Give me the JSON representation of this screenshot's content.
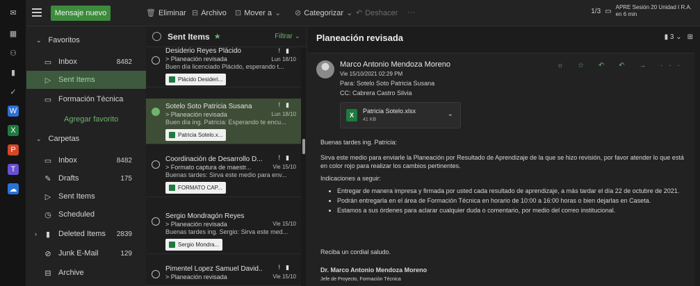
{
  "toolbar": {
    "new_message": "Mensaje nuevo",
    "delete": "Eliminar",
    "archive": "Archivo",
    "move_to": "Mover a",
    "categorize": "Categorizar",
    "undo": "Deshacer",
    "more": "···",
    "page_indicator": "1/3",
    "event_line1": "APRE Sesión 20 Unidad I R.A.",
    "event_line2": "en 6 min"
  },
  "nav": {
    "favorites_label": "Favoritos",
    "favorites": [
      {
        "label": "Inbox",
        "count": "8482",
        "icon": "inbox-icon"
      },
      {
        "label": "Sent Items",
        "count": "",
        "icon": "send-icon"
      },
      {
        "label": "Formación Técnica",
        "count": "",
        "icon": "folder-icon"
      }
    ],
    "add_favorite": "Agregar favorito",
    "folders_label": "Carpetas",
    "folders": [
      {
        "label": "Inbox",
        "count": "8482",
        "icon": "inbox-icon"
      },
      {
        "label": "Drafts",
        "count": "175",
        "icon": "pencil-icon"
      },
      {
        "label": "Sent Items",
        "count": "",
        "icon": "send-icon"
      },
      {
        "label": "Scheduled",
        "count": "",
        "icon": "clock-icon"
      },
      {
        "label": "Deleted Items",
        "count": "2839",
        "icon": "trash-icon"
      },
      {
        "label": "Junk E-Mail",
        "count": "129",
        "icon": "block-icon"
      },
      {
        "label": "Archive",
        "count": "",
        "icon": "archive-icon"
      }
    ]
  },
  "list": {
    "title": "Sent Items",
    "filter": "Filtrar",
    "messages": [
      {
        "from": "Desiderio Reyes Plácido",
        "subject": "> Planeación revisada",
        "date": "Lun 18/10",
        "preview": "Buen día licenciado Plácido, esperando t...",
        "attachment": "Plácido Desideri..."
      },
      {
        "from": "Sotelo Soto Patricia Susana",
        "subject": "> Planeación revisada",
        "date": "Lun 18/10",
        "preview": "Buen día ing. Patricia: Esperando te encu...",
        "attachment": "Patricia Sotelo.x..."
      },
      {
        "from": "Coordinación de Desarrollo D...",
        "subject": "> Formato captura de maestr...",
        "date": "Vie 15/10",
        "preview": "Buenas tardes: Sirva este medio para env...",
        "attachment": "FORMATO CAP..."
      },
      {
        "from": "Sergio Mondragón Reyes",
        "subject": "> Planeación revisada",
        "date": "Vie 15/10",
        "preview": "Buenas tardes ing. Sergio: Sirva este med...",
        "attachment": "Sergio Mondra..."
      },
      {
        "from": "Pimentel Lopez Samuel David...",
        "subject": "> Planeación revisada",
        "date": "Vie 15/10",
        "preview": "",
        "attachment": ""
      }
    ]
  },
  "reading": {
    "title": "Planeación revisada",
    "thread_count": "3",
    "sender": "Marco Antonio Mendoza Moreno",
    "sent": "Vie 15/10/2021 02:29 PM",
    "to": "Para: Sotelo Soto Patricia Susana",
    "cc": "CC: Cabrera Castro Silvia",
    "file_name": "Patricia Sotelo.xlsx",
    "file_size": "41 KB",
    "greeting": "Buenas tardes ing. Patricia:",
    "para1": "Sirva este medio para enviarle la Planeación por Resultado de Aprendizaje de la que se hizo revisión, por favor atender lo que está en color rojo para realizar los cambios pertinentes.",
    "indications": "Indicaciones a seguir:",
    "bullets": [
      "Entregar de manera impresa y firmada por usted cada resultado de aprendizaje, a más tardar el día 22 de octubre de 2021.",
      "Podrán entregarla en el área de Formación Técnica en horario de 10:00 a 16:00 horas o bien dejarlas en Caseta.",
      "Estamos a sus órdenes para aclarar cualquier duda o comentario, por medio del correo institucional."
    ],
    "closing": "Reciba un cordial saludo.",
    "signature_name": "Dr. Marco Antonio Mendoza Moreno",
    "signature_title": "Jefe de Proyecto, Formación Técnica"
  },
  "colors": {
    "accent": "#6fb36f",
    "selected_nav": "#3e5a3e",
    "selected_msg": "#3e4d36"
  }
}
